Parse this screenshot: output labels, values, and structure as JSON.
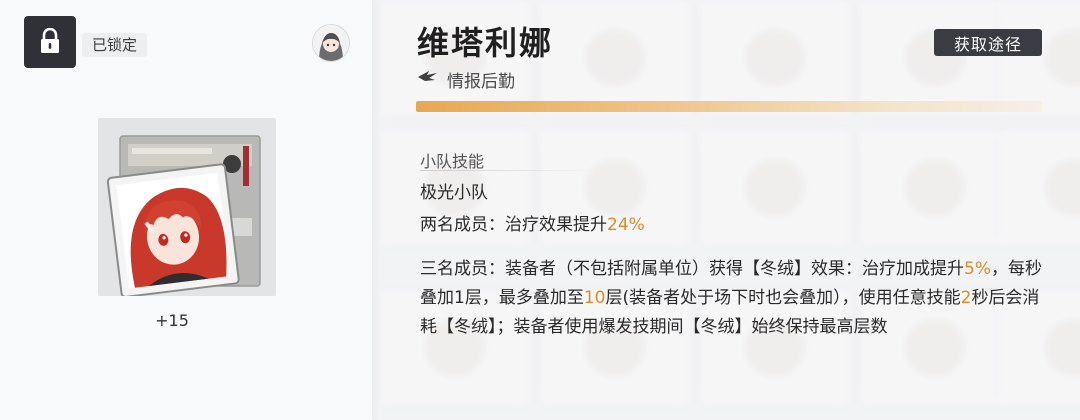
{
  "left": {
    "lock_status": "已锁定",
    "level_text": "+15"
  },
  "character": {
    "name": "维塔利娜",
    "role": "情报后勤"
  },
  "header": {
    "acquire_button": "获取途径"
  },
  "progress": {
    "fill_fraction": 1.0
  },
  "skill": {
    "section_title": "小队技能",
    "squad_name": "极光小队",
    "two_member": {
      "prefix": "两名成员：治疗效果提升",
      "value": "24%"
    },
    "three_member": {
      "t1": "三名成员：装备者（不包括附属单位）获得【冬绒】效果：治疗加成提升",
      "v1": "5%",
      "t2": "，每秒叠加1层，最多叠加至",
      "v2": "10",
      "t3": "层(装备者处于场下时也会叠加），使用任意技能",
      "v3": "2",
      "t4": "秒后会消耗【冬绒】；装备者使用爆发技期间【冬绒】始终保持最高层数"
    }
  },
  "colors": {
    "highlight": "#e08a2c",
    "button_bg": "#3a3c41",
    "lock_bg": "#2f3136",
    "progress_start": "#e8a850"
  },
  "icons": {
    "lock": "lock-icon",
    "role": "logistics-wing-icon",
    "avatar": "character-avatar-icon"
  }
}
